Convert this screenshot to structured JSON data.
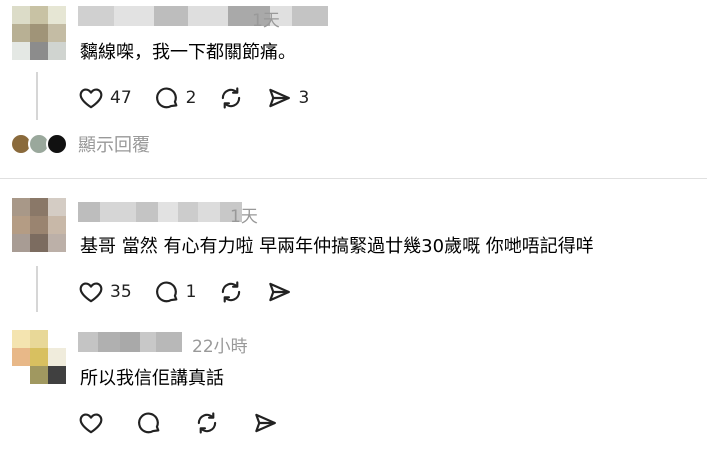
{
  "comments": [
    {
      "time": "1天",
      "text": "黐線㗎，我一下都關節痛。",
      "likes": "47",
      "replies": "2",
      "shares": "3"
    },
    {
      "time": "1天",
      "text": "基哥 當然 有心有力啦 早兩年仲搞緊過廿幾30歲嘅 你哋唔記得咩",
      "likes": "35",
      "replies": "1"
    },
    {
      "time": "22小時",
      "text": "所以我信佢講真話"
    }
  ],
  "show_replies_label": "顯示回覆",
  "icons": {
    "like": "heart-icon",
    "reply": "comment-bubble-icon",
    "repost": "repost-arrows-icon",
    "share": "send-paper-plane-icon"
  }
}
